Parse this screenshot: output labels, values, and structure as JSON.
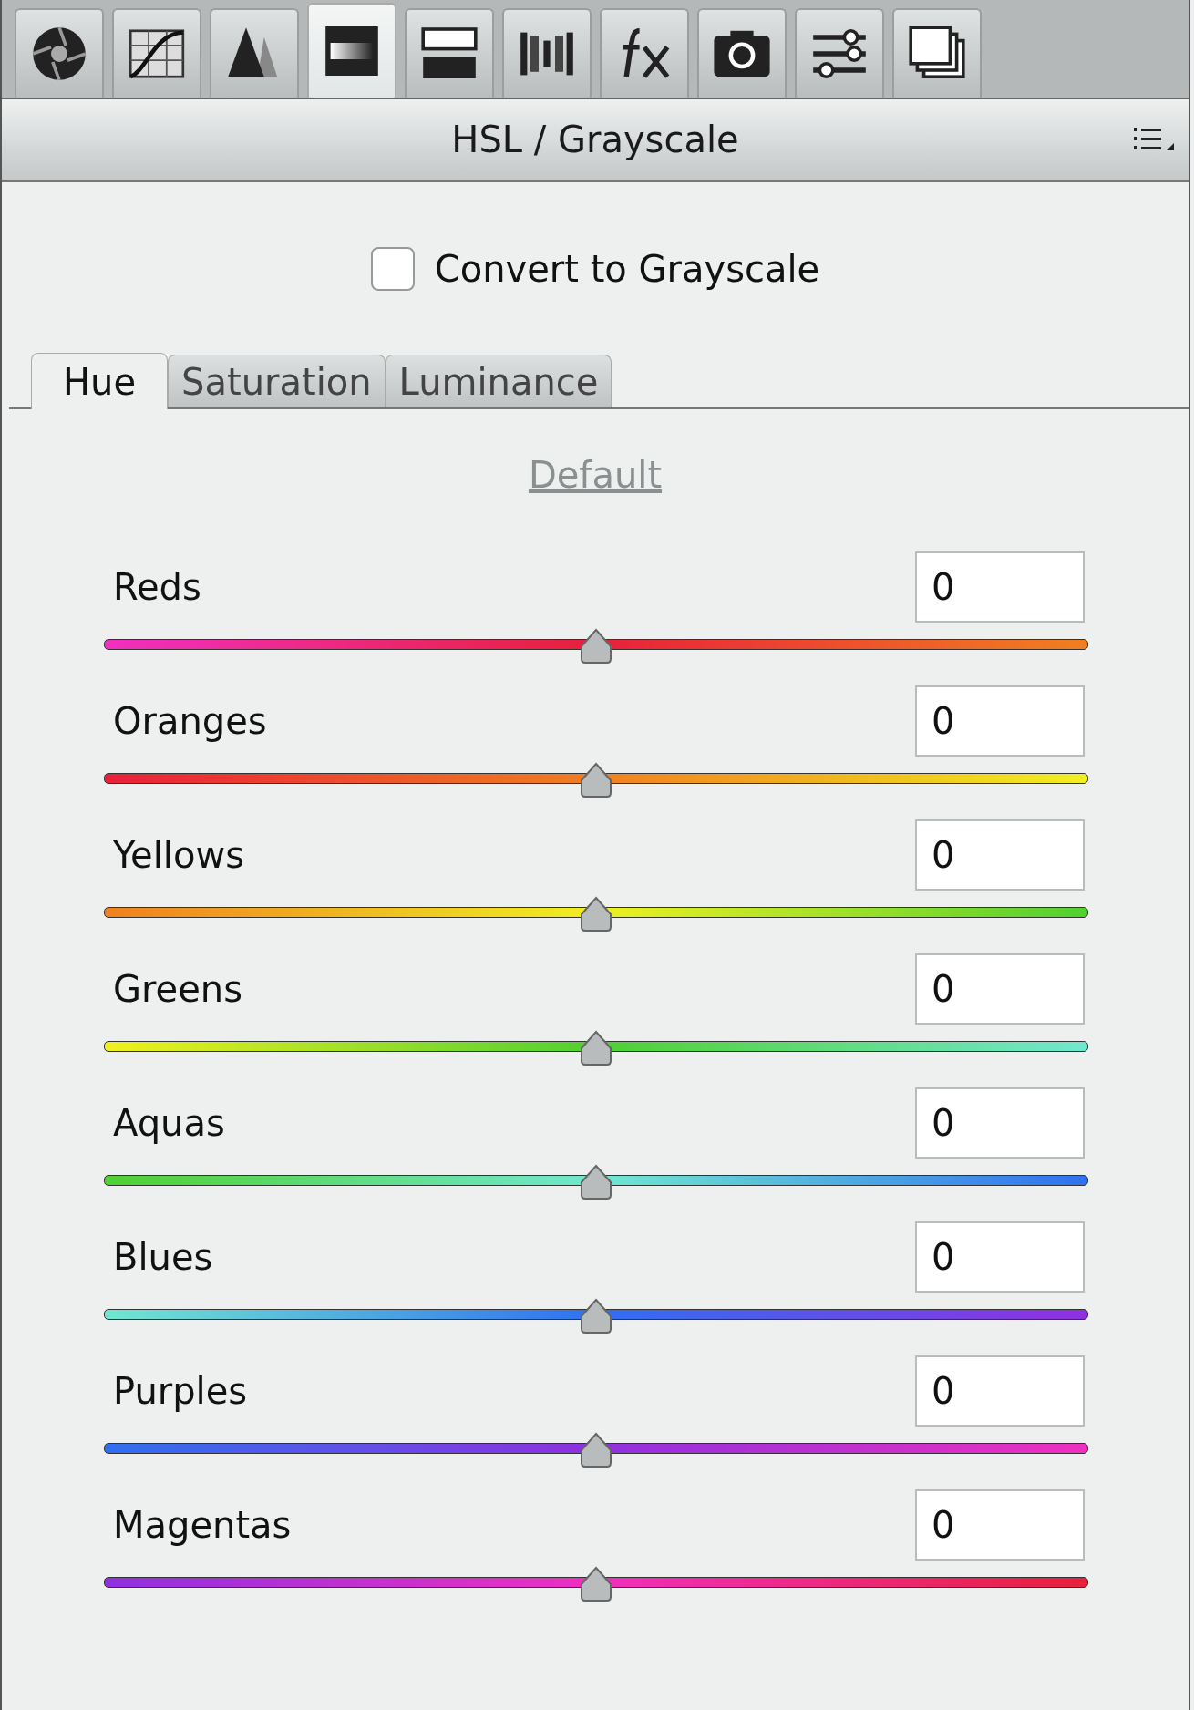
{
  "toolbar": [
    {
      "selected": false
    },
    {
      "selected": false
    },
    {
      "selected": false
    },
    {
      "selected": true
    },
    {
      "selected": false
    },
    {
      "selected": false
    },
    {
      "selected": false
    },
    {
      "selected": false
    },
    {
      "selected": false
    },
    {
      "selected": false
    }
  ],
  "panel": {
    "title": "HSL / Grayscale"
  },
  "grayscale": {
    "label": "Convert to Grayscale",
    "checked": false
  },
  "tabs": [
    {
      "label": "Hue",
      "selected": true
    },
    {
      "label": "Saturation",
      "selected": false
    },
    {
      "label": "Luminance",
      "selected": false
    }
  ],
  "default_link": "Default",
  "sliders": [
    {
      "name": "Reds",
      "value": "0",
      "level": 0.5,
      "color": "#e8203a"
    },
    {
      "name": "Oranges",
      "value": "0",
      "level": 0.5,
      "color": "#f08020"
    },
    {
      "name": "Yellows",
      "value": "0",
      "level": 0.5,
      "color": "#f0f020"
    },
    {
      "name": "Greens",
      "value": "0",
      "level": 0.5,
      "color": "#50d030"
    },
    {
      "name": "Aquas",
      "value": "0",
      "level": 0.5,
      "color": "#70e8d0"
    },
    {
      "name": "Blues",
      "value": "0",
      "level": 0.5,
      "color": "#3070f0"
    },
    {
      "name": "Purples",
      "value": "0",
      "level": 0.5,
      "color": "#9030e0"
    },
    {
      "name": "Magentas",
      "value": "0",
      "level": 0.5,
      "color": "#f030c0"
    }
  ]
}
